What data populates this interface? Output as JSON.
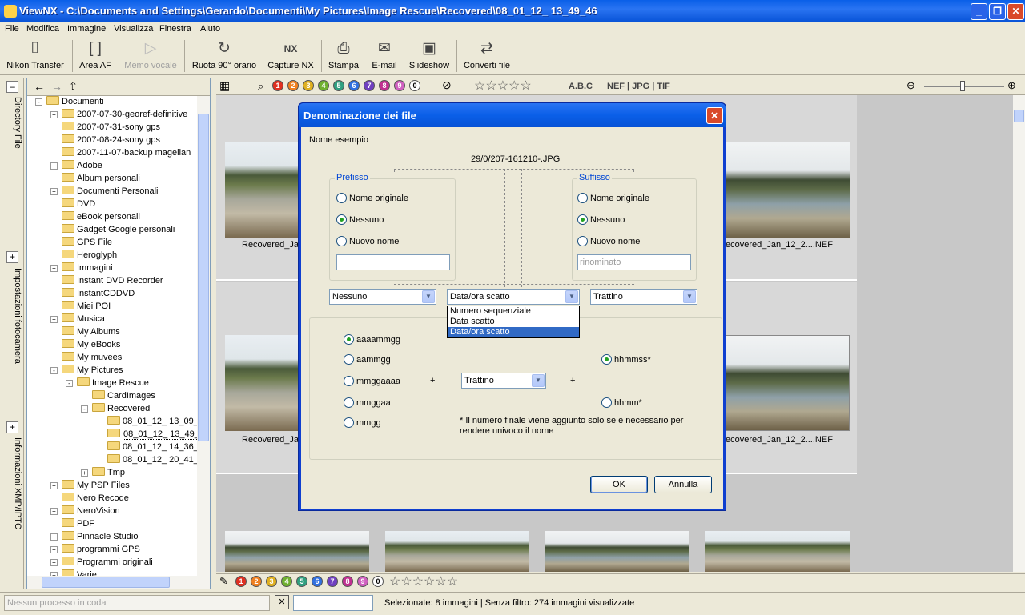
{
  "window": {
    "title": "ViewNX - C:\\Documents and Settings\\Gerardo\\Documenti\\My Pictures\\Image Rescue\\Recovered\\08_01_12_ 13_49_46",
    "minimize": "_",
    "maximize": "❐",
    "close": "✕"
  },
  "menu": [
    "File",
    "Modifica",
    "Immagine",
    "Visualizza",
    "Finestra",
    "Aiuto"
  ],
  "toolbar": [
    {
      "label": "Nikon Transfer",
      "icon": "camera-icon",
      "glyph": "⌷",
      "enabled": true
    },
    {
      "label": "Area AF",
      "icon": "af-area-icon",
      "glyph": "[ ]",
      "enabled": true
    },
    {
      "label": "Memo vocale",
      "icon": "voice-memo-icon",
      "glyph": "▷",
      "enabled": false
    },
    {
      "label": "Ruota 90° orario",
      "icon": "rotate-icon",
      "glyph": "↻",
      "enabled": true
    },
    {
      "label": "Capture NX",
      "icon": "capture-nx-icon",
      "glyph": "NX",
      "enabled": true
    },
    {
      "label": "Stampa",
      "icon": "print-icon",
      "glyph": "⎙",
      "enabled": true
    },
    {
      "label": "E-mail",
      "icon": "email-icon",
      "glyph": "✉",
      "enabled": true
    },
    {
      "label": "Slideshow",
      "icon": "slideshow-icon",
      "glyph": "▣",
      "enabled": true
    },
    {
      "label": "Converti file",
      "icon": "convert-icon",
      "glyph": "⇄",
      "enabled": true
    }
  ],
  "side_tabs": [
    "Directory File",
    "Impostazioni fotocamera",
    "Informazioni XMP/IPTC"
  ],
  "tree": [
    {
      "label": "Documenti",
      "level": 0,
      "exp": "-"
    },
    {
      "label": "2007-07-30-georef-definitive",
      "level": 1,
      "exp": "+"
    },
    {
      "label": "2007-07-31-sony gps",
      "level": 1,
      "exp": ""
    },
    {
      "label": "2007-08-24-sony gps",
      "level": 1,
      "exp": ""
    },
    {
      "label": "2007-11-07-backup magellan",
      "level": 1,
      "exp": ""
    },
    {
      "label": "Adobe",
      "level": 1,
      "exp": "+"
    },
    {
      "label": "Album personali",
      "level": 1,
      "exp": ""
    },
    {
      "label": "Documenti Personali",
      "level": 1,
      "exp": "+"
    },
    {
      "label": "DVD",
      "level": 1,
      "exp": ""
    },
    {
      "label": "eBook personali",
      "level": 1,
      "exp": ""
    },
    {
      "label": "Gadget Google personali",
      "level": 1,
      "exp": ""
    },
    {
      "label": "GPS File",
      "level": 1,
      "exp": ""
    },
    {
      "label": "Heroglyph",
      "level": 1,
      "exp": ""
    },
    {
      "label": "Immagini",
      "level": 1,
      "exp": "+"
    },
    {
      "label": "Instant DVD Recorder",
      "level": 1,
      "exp": ""
    },
    {
      "label": "InstantCDDVD",
      "level": 1,
      "exp": ""
    },
    {
      "label": "Miei POI",
      "level": 1,
      "exp": ""
    },
    {
      "label": "Musica",
      "level": 1,
      "exp": "+"
    },
    {
      "label": "My Albums",
      "level": 1,
      "exp": ""
    },
    {
      "label": "My eBooks",
      "level": 1,
      "exp": ""
    },
    {
      "label": "My muvees",
      "level": 1,
      "exp": ""
    },
    {
      "label": "My Pictures",
      "level": 1,
      "exp": "-"
    },
    {
      "label": "Image Rescue",
      "level": 2,
      "exp": "-"
    },
    {
      "label": "CardImages",
      "level": 3,
      "exp": ""
    },
    {
      "label": "Recovered",
      "level": 3,
      "exp": "-"
    },
    {
      "label": "08_01_12_ 13_09_",
      "level": 4,
      "exp": ""
    },
    {
      "label": "08_01_12_ 13_49_",
      "level": 4,
      "exp": "",
      "selected": true
    },
    {
      "label": "08_01_12_ 14_36_",
      "level": 4,
      "exp": ""
    },
    {
      "label": "08_01_12_ 20_41_",
      "level": 4,
      "exp": ""
    },
    {
      "label": "Tmp",
      "level": 3,
      "exp": "+"
    },
    {
      "label": "My PSP Files",
      "level": 1,
      "exp": "+"
    },
    {
      "label": "Nero Recode",
      "level": 1,
      "exp": ""
    },
    {
      "label": "NeroVision",
      "level": 1,
      "exp": "+"
    },
    {
      "label": "PDF",
      "level": 1,
      "exp": ""
    },
    {
      "label": "Pinnacle Studio",
      "level": 1,
      "exp": "+"
    },
    {
      "label": "programmi GPS",
      "level": 1,
      "exp": "+"
    },
    {
      "label": "Programmi originali",
      "level": 1,
      "exp": "+"
    },
    {
      "label": "Varie",
      "level": 1,
      "exp": "+"
    }
  ],
  "filterbar": {
    "labels": [
      "1",
      "2",
      "3",
      "4",
      "5",
      "6",
      "7",
      "8",
      "9",
      "0"
    ],
    "label_colors": [
      "#e03020",
      "#f08020",
      "#e0b020",
      "#70b030",
      "#30a080",
      "#3070e0",
      "#7040c0",
      "#c03090",
      "#d060c0",
      "#ffffff"
    ],
    "abc": "A.B.C",
    "formats": "NEF | JPG | TIF"
  },
  "thumbs": {
    "captions_row1": [
      "Recovered_Ja",
      "ecovered_Jan_12_2....NEF"
    ],
    "captions_row2": [
      "Recovered_Ja",
      "ecovered_Jan_12_2....NEF"
    ]
  },
  "dialog": {
    "title": "Denominazione dei file",
    "sample_label": "Nome esempio",
    "sample_value": "29/0/207-161210-.JPG",
    "prefix": {
      "title": "Prefisso",
      "options": [
        "Nome originale",
        "Nessuno",
        "Nuovo nome"
      ],
      "selected": 1,
      "input": ""
    },
    "suffix": {
      "title": "Suffisso",
      "options": [
        "Nome originale",
        "Nessuno",
        "Nuovo nome"
      ],
      "selected": 1,
      "input": "rinominato"
    },
    "combo_left": "Nessuno",
    "combo_mid": "Data/ora scatto",
    "combo_right": "Trattino",
    "dropdown": [
      "Numero sequenziale",
      "Data scatto",
      "Data/ora scatto"
    ],
    "dropdown_selected": 2,
    "date_formats": [
      "aaaammgg",
      "aammgg",
      "mmggaaaa",
      "mmggaa",
      "mmgg"
    ],
    "date_selected": 0,
    "time_formats": [
      "hhmmss*",
      "hhmm*"
    ],
    "time_selected": 0,
    "plus1": "+",
    "plus2": "+",
    "separator": "Trattino",
    "note": "* Il numero finale viene aggiunto solo se è necessario per rendere univoco il nome",
    "ok": "OK",
    "cancel": "Annulla"
  },
  "status": {
    "queue": "Nessun processo in coda",
    "cancel_glyph": "✕",
    "info": "Selezionate: 8 immagini | Senza filtro: 274 immagini visualizzate"
  }
}
